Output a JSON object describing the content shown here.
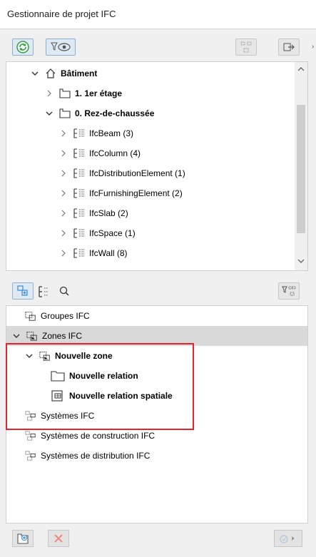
{
  "window": {
    "title": "Gestionnaire de projet IFC"
  },
  "toolbar": {
    "refresh_icon": "refresh-icon",
    "filter_view_icon": "filter-eye-icon",
    "colors": {
      "accent": "#3a8ad1",
      "green": "#2ba33f"
    }
  },
  "tree": {
    "building": "Bâtiment",
    "floor1": "1. 1er étage",
    "floor0": "0. Rez-de-chaussée",
    "items": [
      "IfcBeam (3)",
      "IfcColumn (4)",
      "IfcDistributionElement (1)",
      "IfcFurnishingElement (2)",
      "IfcSlab (2)",
      "IfcSpace (1)",
      "IfcWall (8)"
    ]
  },
  "groups": {
    "groupes": "Groupes IFC",
    "zones": "Zones IFC",
    "nouvelle_zone": "Nouvelle zone",
    "nouvelle_relation": "Nouvelle relation",
    "nouvelle_relation_spatiale": "Nouvelle relation spatiale",
    "systemes": "Systèmes IFC",
    "systemes_construction": "Systèmes de construction IFC",
    "systemes_distribution": "Systèmes de distribution IFC"
  }
}
